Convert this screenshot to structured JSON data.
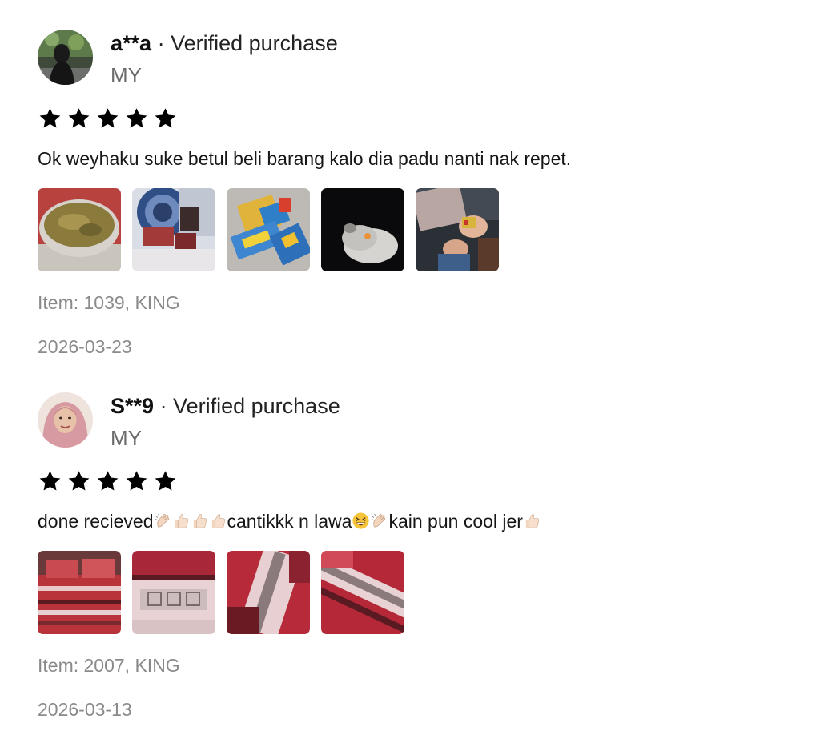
{
  "reviews": [
    {
      "username": "a**a",
      "separator": "·",
      "verified_label": "Verified purchase",
      "country": "MY",
      "rating": 5,
      "text_parts": [
        "Ok weyhaku suke betul beli barang kalo dia padu nanti nak repet."
      ],
      "emoji_icons": [],
      "photo_count": 5,
      "item": "Item: 1039, KING",
      "date": "2026-03-23"
    },
    {
      "username": "S**9",
      "separator": "·",
      "verified_label": "Verified purchase",
      "country": "MY",
      "rating": 5,
      "text_parts": [
        "done recieved",
        "cantikkk n lawa",
        "kain pun cool jer"
      ],
      "emoji_icons": [
        "clapping-hands-icon",
        "thumbs-up-icon",
        "thumbs-up-icon",
        "thumbs-up-icon",
        "grinning-squinting-face-icon",
        "clapping-hands-icon",
        "thumbs-up-icon"
      ],
      "photo_count": 4,
      "item": "Item: 2007, KING",
      "date": "2026-03-13"
    }
  ],
  "colors": {
    "star": "#000000",
    "muted_text": "#8a8a8a",
    "country_text": "#6b6b6b"
  }
}
